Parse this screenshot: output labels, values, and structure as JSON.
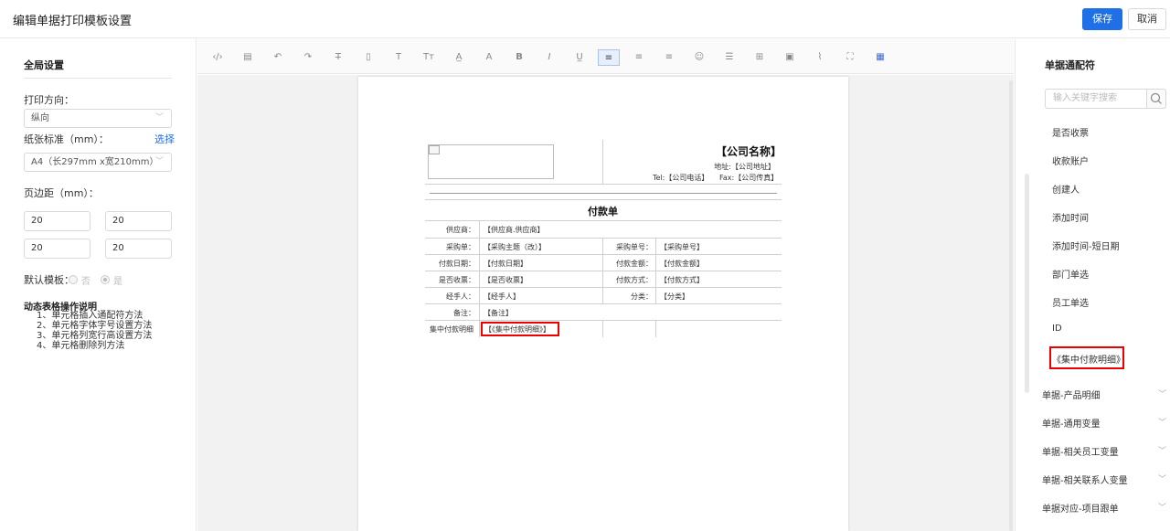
{
  "header": {
    "title": "编辑单据打印模板设置",
    "save_label": "保存",
    "cancel_label": "取消"
  },
  "left": {
    "section_title": "全局设置",
    "orientation_label": "打印方向：",
    "orientation_value": "纵向",
    "paper_label": "纸张标准（mm）：",
    "paper_link": "选择",
    "paper_value": "A4（长297mm x宽210mm）",
    "margin_label": "页边距（mm）：",
    "margins": [
      "20",
      "20",
      "20",
      "20"
    ],
    "default_label": "默认模板：",
    "radio_no": "否",
    "radio_yes": "是",
    "help_title": "动态表格操作说明",
    "help_items": [
      "1、单元格插入通配符方法",
      "2、单元格字体字号设置方法",
      "3、单元格列宽行高设置方法",
      "4、单元格删除列方法"
    ]
  },
  "toolbar": {
    "tools": [
      "code-icon",
      "template-icon",
      "undo-icon",
      "redo-icon",
      "strikethrough-icon",
      "paste-icon",
      "text-icon",
      "font-size-icon",
      "font-color-icon",
      "background-color-icon",
      "bold-icon",
      "italic-icon",
      "underline-icon",
      "align-left-icon",
      "align-center-icon",
      "align-right-icon",
      "emoji-icon",
      "line-height-icon",
      "table-icon",
      "image-icon",
      "attachment-icon",
      "fullscreen-icon",
      "grid-icon"
    ],
    "glyphs": [
      "‹/›",
      "▤",
      "↶",
      "↷",
      "T̶",
      "▯",
      "T",
      "Tт",
      "A̲",
      "A",
      "B",
      "I",
      "U̲",
      "≡",
      "≡",
      "≡",
      "☺",
      "☰",
      "⊞",
      "▣",
      "⌇",
      "⛶",
      "▦"
    ]
  },
  "document": {
    "company": "【公司名称】",
    "address": "地址:【公司地址】",
    "tel": "Tel:【公司电话】",
    "fax": "Fax:【公司传真】",
    "title": "付款单",
    "rows": {
      "supplier_label": "供应商：",
      "supplier_value": "【供应商.供应商】",
      "purchase_label": "采购单：",
      "purchase_value": "【采购主题（改）】",
      "purchase_no_label": "采购单号：",
      "purchase_no_value": "【采购单号】",
      "pay_date_label": "付款日期：",
      "pay_date_value": "【付款日期】",
      "pay_amount_label": "付款金额：",
      "pay_amount_value": "【付款金额】",
      "invoice_label": "是否收票：",
      "invoice_value": "【是否收票】",
      "pay_method_label": "付款方式：",
      "pay_method_value": "【付款方式】",
      "handler_label": "经手人：",
      "handler_value": "【经手人】",
      "category_label": "分类：",
      "category_value": "【分类】",
      "remark_label": "备注：",
      "remark_value": "【备注】",
      "detail_label": "集中付款明细",
      "detail_value": "【《集中付款明细》】"
    }
  },
  "right": {
    "section_title": "单据通配符",
    "search_placeholder": "输入关键字搜索",
    "items": [
      "是否收票",
      "收款账户",
      "创建人",
      "添加时间",
      "添加时间-短日期",
      "部门单选",
      "员工单选",
      "ID",
      "《集中付款明细》"
    ],
    "groups": [
      "单据-产品明细",
      "单据-通用变量",
      "单据-相关员工变量",
      "单据-相关联系人变量",
      "单据对应-项目跟单"
    ]
  }
}
